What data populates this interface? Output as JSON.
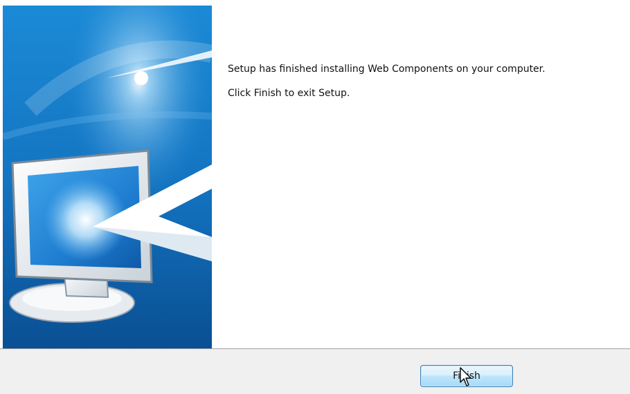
{
  "content": {
    "line1": "Setup has finished installing Web Components on your computer.",
    "line2": "Click Finish to exit Setup."
  },
  "footer": {
    "finish_label": "Finish"
  },
  "icons": {
    "banner": "monitor-with-arrow-illustration",
    "cursor": "mouse-pointer-icon"
  },
  "colors": {
    "banner_blue": "#1678c2",
    "button_border": "#3c7fb1",
    "footer_bg": "#f0f0f0"
  }
}
